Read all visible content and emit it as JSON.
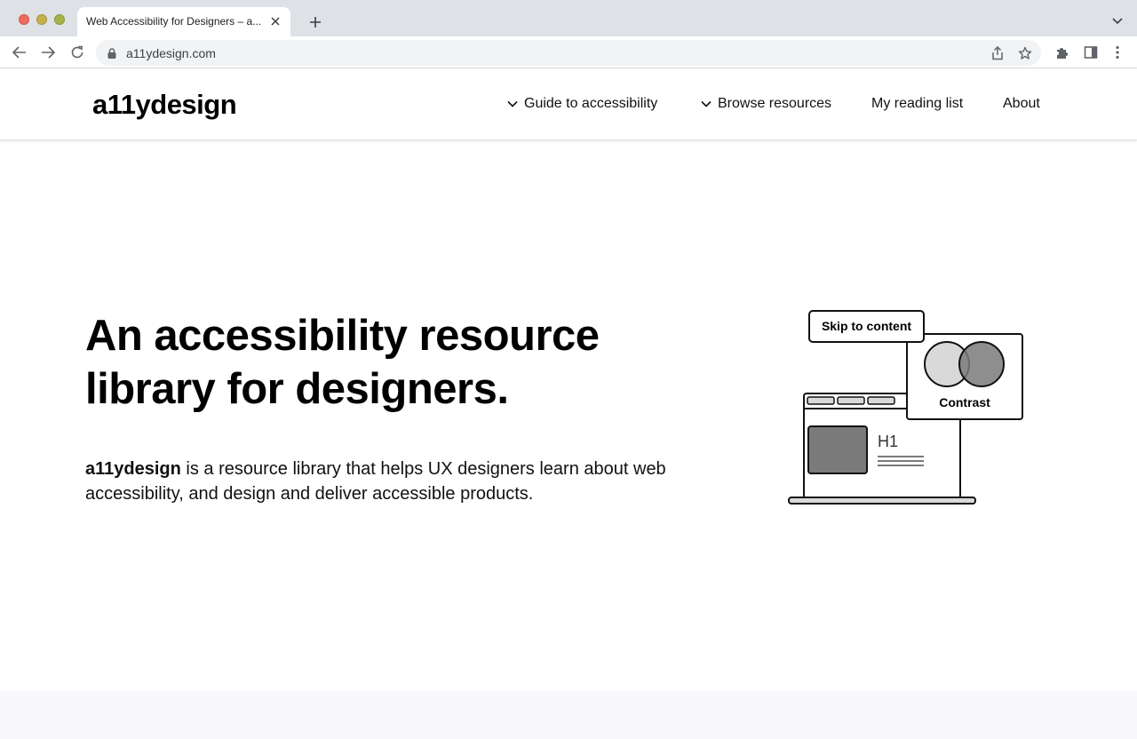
{
  "browser": {
    "tab_title": "Web Accessibility for Designers – a...",
    "url": "a11ydesign.com"
  },
  "site": {
    "logo": "a11ydesign",
    "nav": [
      {
        "label": "Guide to accessibility"
      },
      {
        "label": "Browse resources"
      },
      {
        "label": "My reading list"
      },
      {
        "label": "About"
      }
    ]
  },
  "hero": {
    "title_line1": "An accessibility resource",
    "title_line2": "library for designers.",
    "desc_brand": "a11ydesign",
    "desc_rest": " is a resource library that helps UX designers learn about web accessibility, and design and deliver accessible products."
  },
  "illustration": {
    "skip_label": "Skip to content",
    "contrast_label": "Contrast",
    "heading_label": "H1"
  },
  "colors": {
    "accent_dark": "#000000",
    "illustration_grey": "#7a7a7a",
    "illustration_light": "#d9d9d9",
    "band_background": "#f9f8fd"
  }
}
